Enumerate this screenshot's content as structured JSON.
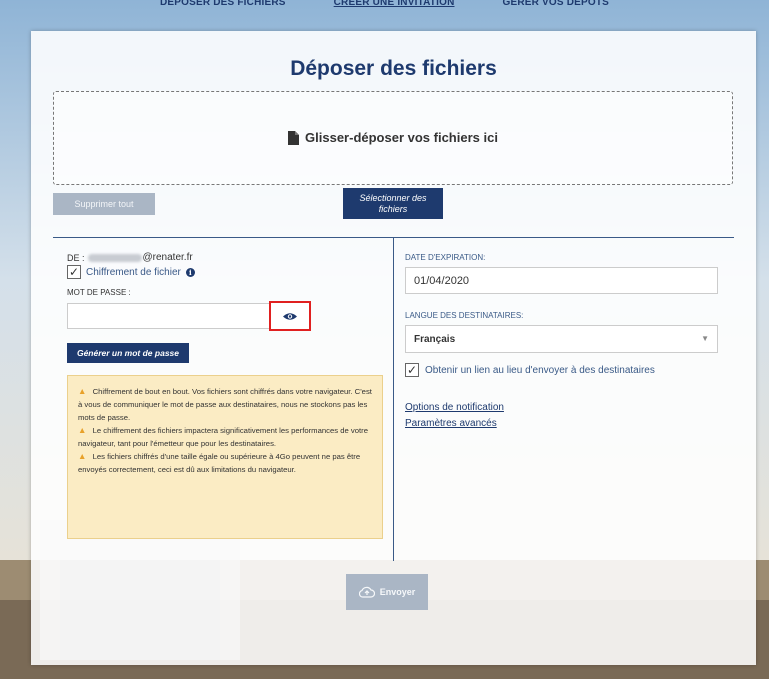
{
  "nav": {
    "items": [
      "DÉPOSER DES FICHIERS",
      "CRÉER UNE INVITATION",
      "GÉRER VOS DÉPÔTS"
    ]
  },
  "page_title": "Déposer des fichiers",
  "dropzone": {
    "text": "Glisser-déposer vos fichiers ici",
    "icon": "file-icon"
  },
  "buttons": {
    "clear_all": "Supprimer tout",
    "select_files": "Sélectionner des fichiers",
    "generate_password": "Générer un mot de passe",
    "send": "Envoyer"
  },
  "sender": {
    "label": "De :",
    "email_suffix": "@renater.fr"
  },
  "encryption": {
    "label": "Chiffrement de fichier",
    "checked": true
  },
  "password": {
    "label": "Mot de passe :",
    "value": ""
  },
  "warnings": [
    "Chiffrement de bout en bout. Vos fichiers sont chiffrés dans votre navigateur. C'est à vous de communiquer le mot de passe aux destinataires, nous ne stockons pas les mots de passe.",
    "Le chiffrement des fichiers impactera significativement les performances de votre navigateur, tant pour l'émetteur que pour les destinataires.",
    "Les fichiers chiffrés d'une taille égale ou supérieure à 4Go peuvent ne pas être envoyés correctement, ceci est dû aux limitations du navigateur."
  ],
  "expiration": {
    "label": "Date d'expiration:",
    "value": "01/04/2020"
  },
  "language": {
    "label": "Langue des destinataires:",
    "value": "Français"
  },
  "link_option": {
    "label": "Obtenir un lien au lieu d'envoyer à des destinataires",
    "checked": true
  },
  "links": {
    "notification_options": "Options de notification",
    "advanced_settings": "Paramètres avancés"
  },
  "colors": {
    "primary": "#1e3a6e",
    "disabled": "#aab6c5",
    "warning_bg": "#fbecc4",
    "highlight": "#e02020"
  }
}
